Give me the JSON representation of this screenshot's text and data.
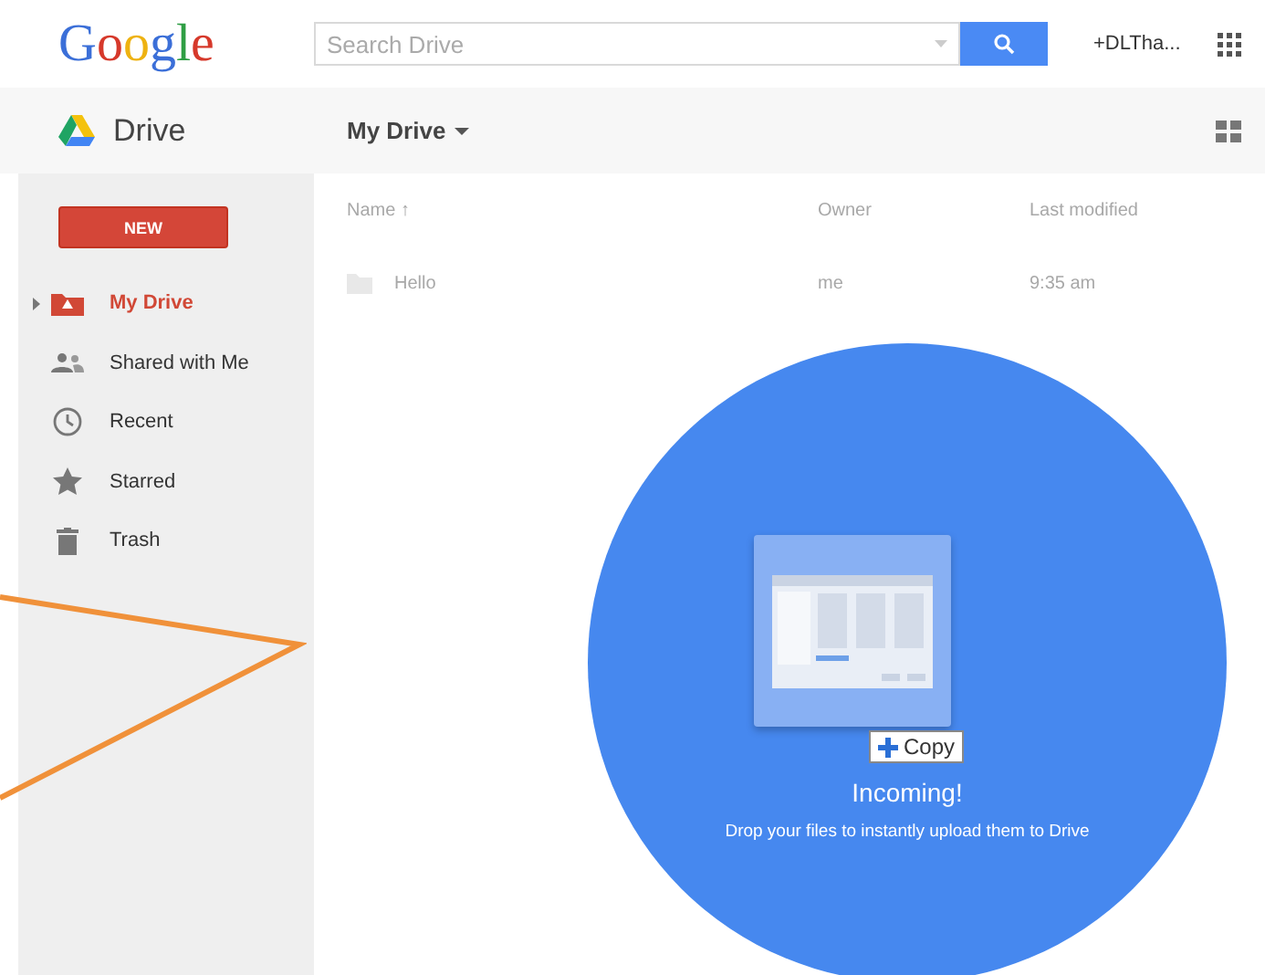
{
  "header": {
    "logo": "Google",
    "search": {
      "placeholder": "Search Drive"
    },
    "account": "+DLTha..."
  },
  "subheader": {
    "app": "Drive",
    "location": "My Drive"
  },
  "sidebar": {
    "new_button": "NEW",
    "items": [
      {
        "label": "My Drive",
        "kind": "drive",
        "selected": true
      },
      {
        "label": "Shared with Me",
        "kind": "shared",
        "selected": false
      },
      {
        "label": "Recent",
        "kind": "recent",
        "selected": false
      },
      {
        "label": "Starred",
        "kind": "starred",
        "selected": false
      },
      {
        "label": "Trash",
        "kind": "trash",
        "selected": false
      }
    ]
  },
  "table": {
    "columns": [
      "Name ↑",
      "Owner",
      "Last modified"
    ],
    "rows": [
      [
        "Hello",
        "me",
        "9:35 am"
      ]
    ]
  },
  "drop_overlay": {
    "badge": "Copy",
    "title": "Incoming!",
    "message": "Drop your files to instantly upload them to Drive"
  }
}
